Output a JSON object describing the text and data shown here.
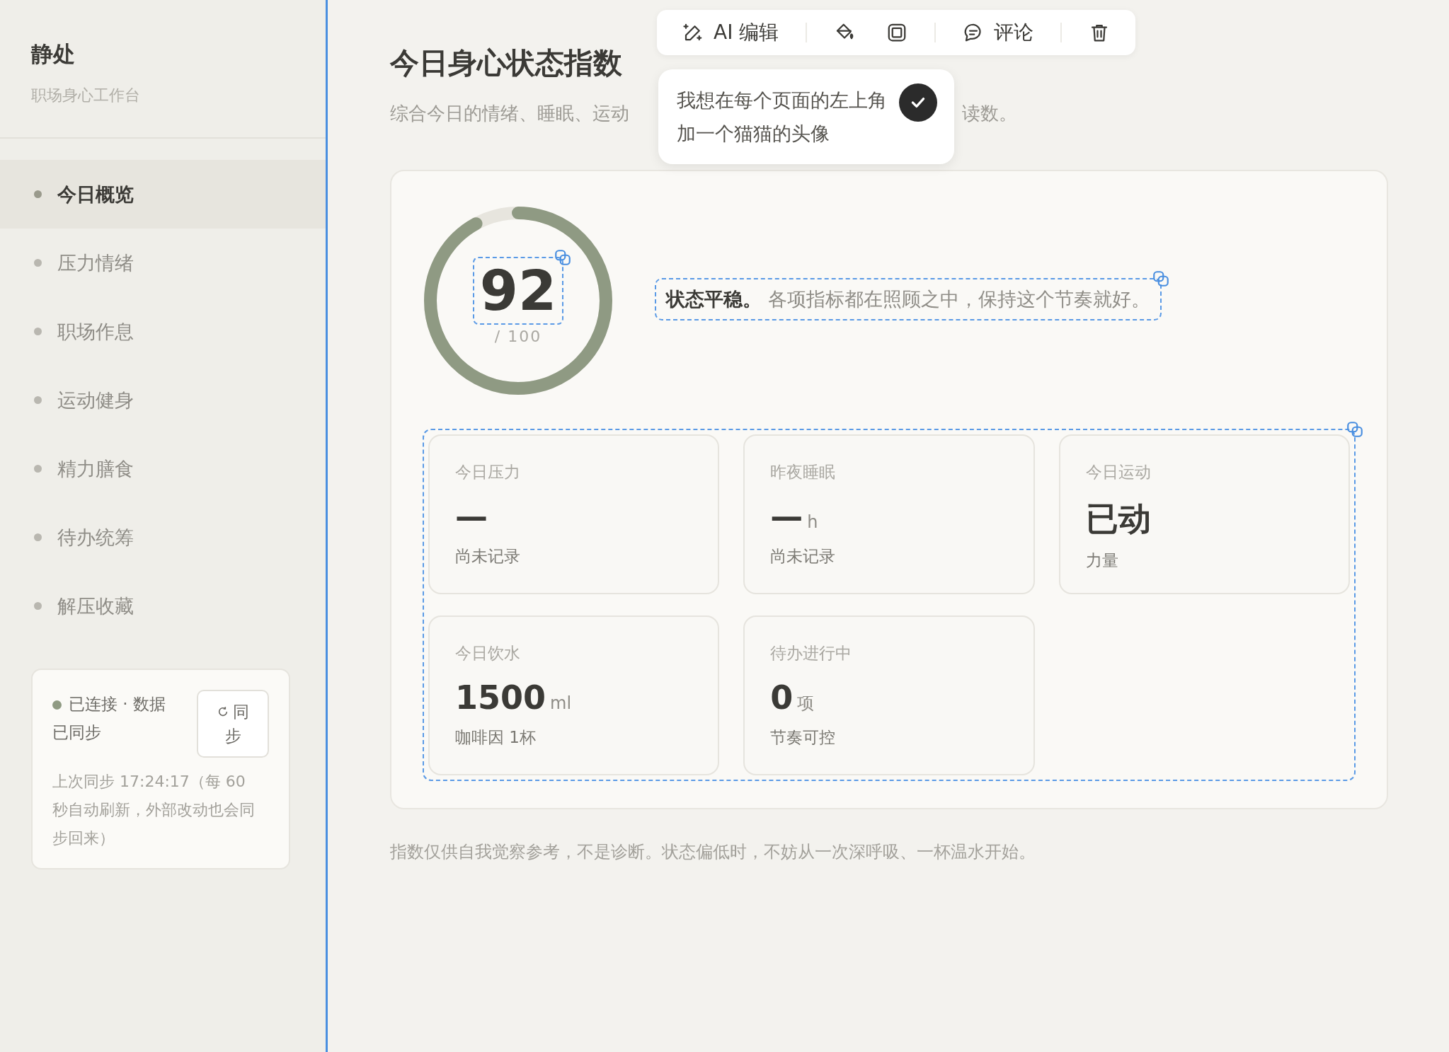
{
  "sidebar": {
    "brand": "静处",
    "tagline": "职场身心工作台",
    "items": [
      {
        "label": "今日概览",
        "selected": true
      },
      {
        "label": "压力情绪",
        "selected": false
      },
      {
        "label": "职场作息",
        "selected": false
      },
      {
        "label": "运动健身",
        "selected": false
      },
      {
        "label": "精力膳食",
        "selected": false
      },
      {
        "label": "待办统筹",
        "selected": false
      },
      {
        "label": "解压收藏",
        "selected": false
      }
    ],
    "sync": {
      "connected": true,
      "status": "已连接 · 数据已同步",
      "button": "同步",
      "note": "上次同步 17:24:17（每 60 秒自动刷新，外部改动也会同步回来）"
    }
  },
  "toolbar": {
    "items": [
      {
        "kind": "ai",
        "label": "AI 编辑"
      },
      {
        "kind": "fill"
      },
      {
        "kind": "frame"
      },
      {
        "kind": "comment",
        "label": "评论"
      },
      {
        "kind": "delete"
      }
    ]
  },
  "comment_popover": {
    "text": "我想在每个页面的左上角加一个猫猫的头像"
  },
  "main": {
    "title": "今日身心状态指数",
    "subtitle_parts": [
      "综合今日的情绪、睡眠、运动",
      "读数。"
    ],
    "score": {
      "value": "92",
      "max": "/ 100",
      "level": 0.92
    },
    "summary": "**状态平稳。** 各项指标都在照顾之中，保持这个节奏就好。",
    "stats": [
      {
        "label": "今日压力",
        "value": "—",
        "note": "尚未记录"
      },
      {
        "label": "昨夜睡眠",
        "value": "—",
        "unit": "h",
        "note": "尚未记录"
      },
      {
        "label": "今日运动",
        "value": "已动",
        "note": "力量"
      },
      {
        "label": "今日饮水",
        "value": "1500",
        "unit": "ml",
        "note": "咖啡因 1杯"
      },
      {
        "label": "待办进行中",
        "value": "0",
        "unit": "项",
        "note": "节奏可控"
      }
    ],
    "footnote": "指数仅供自我觉察参考，不是诊断。状态偏低时，不妨从一次深呼吸、一杯温水开始。"
  }
}
